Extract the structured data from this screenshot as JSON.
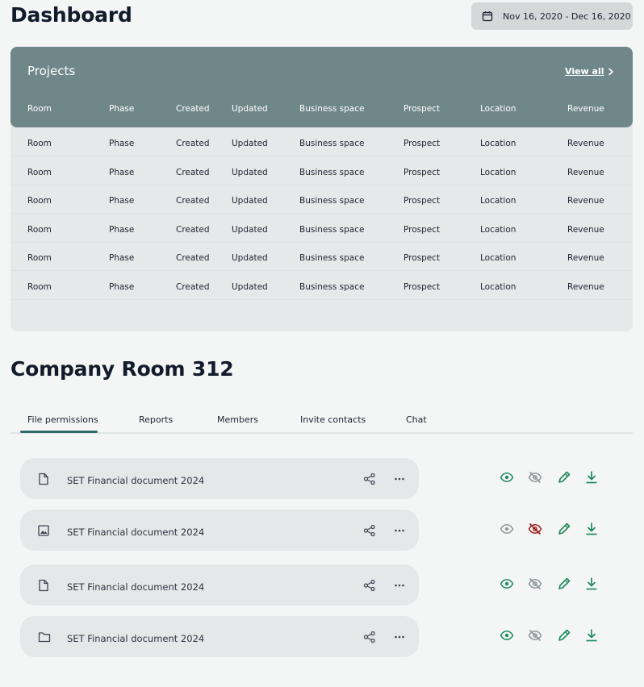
{
  "header": {
    "title": "Dashboard",
    "date_range": "Nov 16, 2020 - Dec 16, 2020"
  },
  "projects": {
    "title": "Projects",
    "view_all": "View all",
    "columns": [
      "Room",
      "Phase",
      "Created",
      "Updated",
      "Business space",
      "Prospect",
      "Location",
      "Revenue"
    ],
    "rows": [
      [
        "Room",
        "Phase",
        "Created",
        "Updated",
        "Business space",
        "Prospect",
        "Location",
        "Revenue"
      ],
      [
        "Room",
        "Phase",
        "Created",
        "Updated",
        "Business space",
        "Prospect",
        "Location",
        "Revenue"
      ],
      [
        "Room",
        "Phase",
        "Created",
        "Updated",
        "Business space",
        "Prospect",
        "Location",
        "Revenue"
      ],
      [
        "Room",
        "Phase",
        "Created",
        "Updated",
        "Business space",
        "Prospect",
        "Location",
        "Revenue"
      ],
      [
        "Room",
        "Phase",
        "Created",
        "Updated",
        "Business space",
        "Prospect",
        "Location",
        "Revenue"
      ],
      [
        "Room",
        "Phase",
        "Created",
        "Updated",
        "Business space",
        "Prospect",
        "Location",
        "Revenue"
      ]
    ]
  },
  "room": {
    "title": "Company Room 312",
    "tabs": [
      {
        "label": "File permissions",
        "active": true
      },
      {
        "label": "Reports"
      },
      {
        "label": "Members"
      },
      {
        "label": "Invite contacts"
      },
      {
        "label": "Chat"
      }
    ],
    "files": [
      {
        "name": "SET Financial document 2024",
        "type_icon": "document-icon",
        "view_enabled": true,
        "hidden_active": false
      },
      {
        "name": "SET Financial document 2024",
        "type_icon": "image-icon",
        "view_enabled": false,
        "hidden_active": true
      },
      {
        "name": "SET Financial document 2024",
        "type_icon": "document-icon",
        "view_enabled": true,
        "hidden_active": false
      },
      {
        "name": "SET Financial document 2024",
        "type_icon": "folder-icon",
        "view_enabled": true,
        "hidden_active": false
      }
    ]
  },
  "colors": {
    "accent": "#1f8a5c",
    "danger": "#9b1c1c",
    "muted": "#8f9698",
    "header_bg": "#6f8789"
  }
}
